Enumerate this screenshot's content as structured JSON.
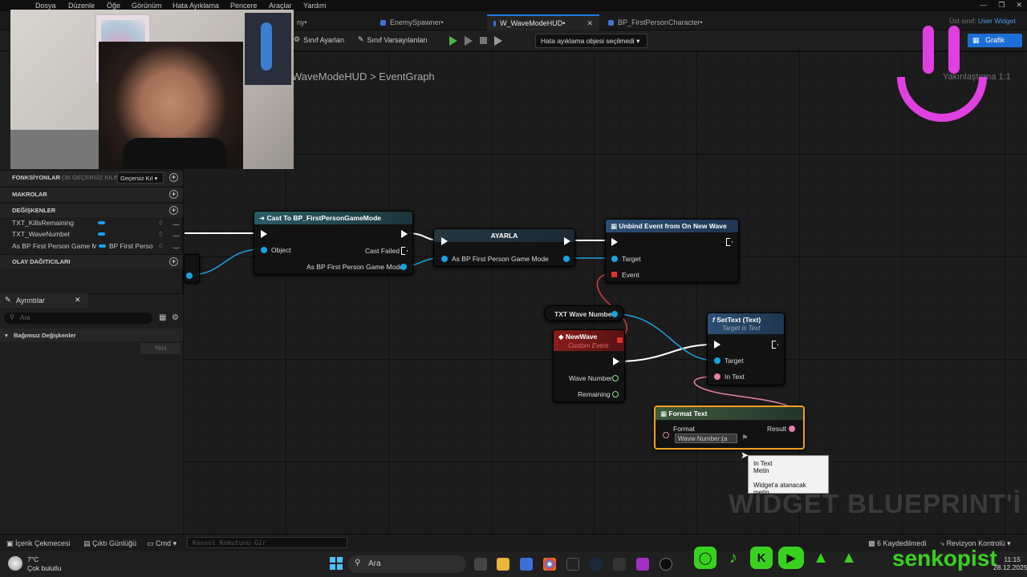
{
  "menubar": {
    "items": [
      "Dosya",
      "Düzenle",
      "Öğe",
      "Görünüm",
      "Hata Ayıklama",
      "Pencere",
      "Araçlar",
      "Yardım"
    ]
  },
  "tabs": [
    {
      "label": "ny•"
    },
    {
      "label": "EnemySpawner•"
    },
    {
      "label": "W_WaveModeHUD•",
      "active": true
    },
    {
      "label": "BP_FirstPersonCharacter•"
    }
  ],
  "parent_class": {
    "label": "Üst sınıf:",
    "value": "User Widget"
  },
  "toolbar": {
    "class_settings": "Sınıf Ayarları",
    "class_defaults": "Sınıf Varsayılanları",
    "debug_select": "Hata ayıklama objesi seçilmedi",
    "graph_button": "Grafik"
  },
  "graph": {
    "breadcrumb_class": "WaveModeHUD",
    "breadcrumb_sep": ">",
    "breadcrumb_graph": "EventGraph",
    "zoom": "Yakınlaştırma 1:1",
    "watermark": "WIDGET BLUEPRINT'İ"
  },
  "left_panel": {
    "functions": {
      "label": "FONKSİYONLAR",
      "count": "(36 GEÇERSİZ KILINAB",
      "dropdown": "Geçersiz Kıl"
    },
    "macros": "MAKROLAR",
    "variables": {
      "label": "DEĞİŞKENLER",
      "items": [
        {
          "name": "TXT_KillsRemaining"
        },
        {
          "name": "TXT_WaveNumbet"
        },
        {
          "name": "As BP First Person Game M",
          "type": "BP First Perso"
        }
      ]
    },
    "dispatchers": "OLAY DAĞITICILARI"
  },
  "details": {
    "tab": "Ayrıntılar",
    "search_placeholder": "Ara",
    "category": "Bağımsız Değişkenler",
    "new_button": "Yeni"
  },
  "nodes": {
    "cast": {
      "title": "Cast To BP_FirstPersonGameMode",
      "object": "Object",
      "cast_failed": "Cast Failed",
      "as": "As BP First Person Game Mode"
    },
    "set": {
      "title": "AYARLA",
      "as": "As BP First Person Game Mode"
    },
    "unbind": {
      "title": "Unbind Event from On New Wave",
      "target": "Target",
      "event": "Event"
    },
    "txt_get": {
      "label": "TXT Wave Numbet"
    },
    "newwave": {
      "title": "NewWave",
      "subtitle": "Custom Event",
      "wave_number": "Wave Number",
      "remaining": "Remaining"
    },
    "settext": {
      "title": "SetText (Text)",
      "subtitle": "Target is Text",
      "target": "Target",
      "in_text": "In Text"
    },
    "format": {
      "title": "Format Text",
      "format": "Format",
      "result": "Result",
      "value": "Wavw Number:{a"
    }
  },
  "tooltip": {
    "line1": "In Text",
    "line2": "Metin",
    "line3": "Widget'a atanacak metin"
  },
  "bottom": {
    "content_drawer": "İçerik Çekmecesi",
    "output_log": "Çıktı Günlüğü",
    "cmd": "Cmd",
    "console_placeholder": "Konsol Komutunu Gir",
    "saved": "6 Kaydedilmedi",
    "revision": "Revizyon Kontrolü"
  },
  "taskbar": {
    "weather_temp": "7°C",
    "weather_desc": "Çok bulutlu",
    "search": "Ara",
    "brand": "senkopist",
    "time": "11:15",
    "date": "28.12.2025"
  },
  "colors": {
    "accent": "#1c6fd6",
    "brand": "#39d120",
    "cast_header": "#2b5c66",
    "event_header": "#8a1b1b",
    "function_header": "#2d4f74"
  }
}
